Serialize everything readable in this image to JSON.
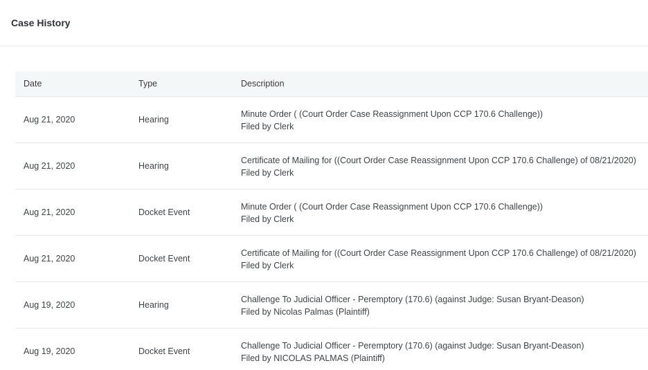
{
  "header": {
    "title": "Case History"
  },
  "table": {
    "columns": [
      "Date",
      "Type",
      "Description"
    ],
    "rows": [
      {
        "date": "Aug 21, 2020",
        "type": "Hearing",
        "description": "Minute Order ( (Court Order Case Reassignment Upon CCP 170.6 Challenge))",
        "filed_by": "Filed by Clerk"
      },
      {
        "date": "Aug 21, 2020",
        "type": "Hearing",
        "description": "Certificate of Mailing for ((Court Order Case Reassignment Upon CCP 170.6 Challenge) of 08/21/2020)",
        "filed_by": "Filed by Clerk"
      },
      {
        "date": "Aug 21, 2020",
        "type": "Docket Event",
        "description": "Minute Order ( (Court Order Case Reassignment Upon CCP 170.6 Challenge))",
        "filed_by": "Filed by Clerk"
      },
      {
        "date": "Aug 21, 2020",
        "type": "Docket Event",
        "description": "Certificate of Mailing for ((Court Order Case Reassignment Upon CCP 170.6 Challenge) of 08/21/2020)",
        "filed_by": "Filed by Clerk"
      },
      {
        "date": "Aug 19, 2020",
        "type": "Hearing",
        "description": "Challenge To Judicial Officer - Peremptory (170.6) (against Judge: Susan Bryant-Deason)",
        "filed_by": "Filed by Nicolas Palmas (Plaintiff)"
      },
      {
        "date": "Aug 19, 2020",
        "type": "Docket Event",
        "description": "Challenge To Judicial Officer - Peremptory (170.6) (against Judge: Susan Bryant-Deason)",
        "filed_by": "Filed by NICOLAS PALMAS (Plaintiff)"
      }
    ]
  },
  "colors": {
    "header_row_bg": "#f3f7f8",
    "divider": "#e3e7ea",
    "text": "#3f4347"
  }
}
